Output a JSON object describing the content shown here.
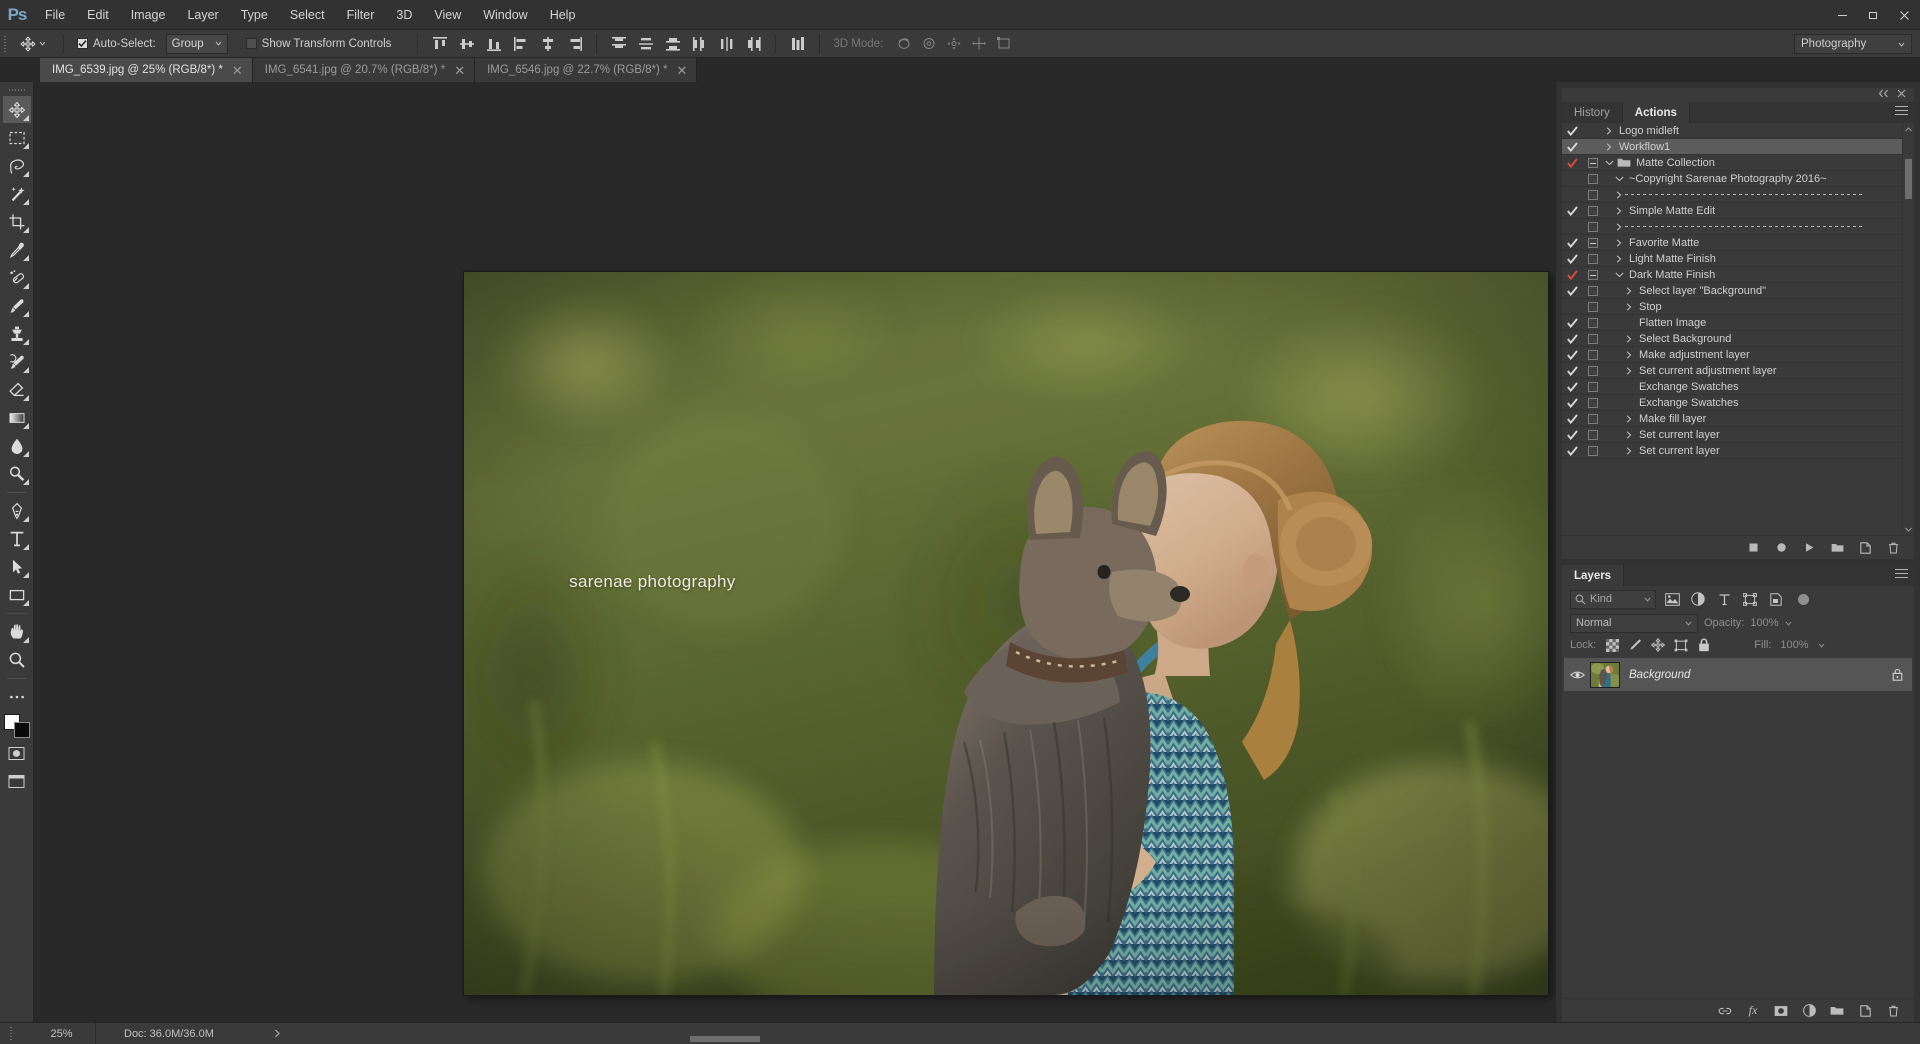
{
  "app": {
    "logo": "Ps",
    "menu": [
      "File",
      "Edit",
      "Image",
      "Layer",
      "Type",
      "Select",
      "Filter",
      "3D",
      "View",
      "Window",
      "Help"
    ],
    "window_controls": [
      "minimize",
      "restore",
      "close"
    ]
  },
  "options_bar": {
    "auto_select_label": "Auto-Select:",
    "auto_select_checked": true,
    "auto_select_value": "Group",
    "show_transform_label": "Show Transform Controls",
    "show_transform_checked": false,
    "mode_3d_label": "3D Mode:",
    "workspace": "Photography",
    "align_icons": [
      "align-top-edges",
      "align-vertical-centers",
      "align-bottom-edges",
      "align-left-edges",
      "align-horizontal-centers",
      "align-right-edges",
      "distribute-top-edges",
      "distribute-vertical-centers",
      "distribute-bottom-edges",
      "distribute-left-edges",
      "distribute-horizontal-centers",
      "distribute-right-edges",
      "align-distribute-options"
    ],
    "mode_3d_icons": [
      "3d-orbit",
      "3d-roll",
      "3d-pan",
      "3d-slide",
      "3d-scale"
    ]
  },
  "tabs": [
    {
      "label": "IMG_6539.jpg @ 25% (RGB/8*) *",
      "active": true
    },
    {
      "label": "IMG_6541.jpg @ 20.7% (RGB/8*) *",
      "active": false
    },
    {
      "label": "IMG_6546.jpg @ 22.7% (RGB/8*) *",
      "active": false
    }
  ],
  "toolbox": [
    {
      "name": "move-tool",
      "active": true,
      "more": true
    },
    {
      "name": "rectangular-marquee-tool",
      "active": false,
      "more": true
    },
    {
      "name": "lasso-tool",
      "active": false,
      "more": true
    },
    {
      "name": "magic-wand-tool",
      "active": false,
      "more": true
    },
    {
      "name": "crop-tool",
      "active": false,
      "more": true
    },
    {
      "name": "eyedropper-tool",
      "active": false,
      "more": true
    },
    {
      "name": "spot-healing-brush-tool",
      "active": false,
      "more": true
    },
    {
      "name": "brush-tool",
      "active": false,
      "more": true
    },
    {
      "name": "clone-stamp-tool",
      "active": false,
      "more": true
    },
    {
      "name": "history-brush-tool",
      "active": false,
      "more": true
    },
    {
      "name": "eraser-tool",
      "active": false,
      "more": true
    },
    {
      "name": "gradient-tool",
      "active": false,
      "more": true
    },
    {
      "name": "blur-tool",
      "active": false,
      "more": true
    },
    {
      "name": "dodge-tool",
      "active": false,
      "more": true
    },
    {
      "name": "pen-tool",
      "active": false,
      "more": true
    },
    {
      "name": "type-tool",
      "active": false,
      "more": true
    },
    {
      "name": "path-selection-tool",
      "active": false,
      "more": true
    },
    {
      "name": "rectangle-tool",
      "active": false,
      "more": true
    },
    {
      "name": "hand-tool",
      "active": false,
      "more": true
    },
    {
      "name": "zoom-tool",
      "active": false,
      "more": false
    },
    {
      "name": "edit-toolbar-tool",
      "active": false,
      "more": false
    }
  ],
  "canvas": {
    "watermark": "sarenae photography",
    "image_alt": "girl holding and kissing a yorkshire terrier in a green field"
  },
  "panels": {
    "actions": {
      "tabs": [
        {
          "label": "History",
          "active": false
        },
        {
          "label": "Actions",
          "active": true
        }
      ],
      "rows": [
        {
          "label": "Logo midleft",
          "checked": true,
          "box": "none",
          "arrow": "right",
          "indent": 0,
          "kind": "action",
          "selected": false
        },
        {
          "label": "Workflow1",
          "checked": true,
          "box": "none",
          "arrow": "right",
          "indent": 0,
          "kind": "action",
          "selected": true
        },
        {
          "label": "Matte Collection",
          "checked": "red",
          "box": "minus",
          "arrow": "down",
          "indent": 0,
          "kind": "set",
          "selected": false
        },
        {
          "label": "~Copyright Sarenae Photography 2016~",
          "checked": false,
          "box": "empty",
          "arrow": "down",
          "indent": 1,
          "kind": "action",
          "selected": false
        },
        {
          "label": "",
          "checked": false,
          "box": "empty",
          "arrow": "right",
          "indent": 1,
          "kind": "divider",
          "selected": false
        },
        {
          "label": "Simple Matte Edit",
          "checked": true,
          "box": "empty",
          "arrow": "right",
          "indent": 1,
          "kind": "action",
          "selected": false
        },
        {
          "label": "",
          "checked": false,
          "box": "empty",
          "arrow": "right",
          "indent": 1,
          "kind": "divider",
          "selected": false
        },
        {
          "label": "Favorite Matte",
          "checked": true,
          "box": "minus",
          "arrow": "right",
          "indent": 1,
          "kind": "action",
          "selected": false
        },
        {
          "label": "Light Matte Finish",
          "checked": true,
          "box": "empty",
          "arrow": "right",
          "indent": 1,
          "kind": "action",
          "selected": false
        },
        {
          "label": "Dark Matte Finish",
          "checked": "red",
          "box": "minus",
          "arrow": "down",
          "indent": 1,
          "kind": "action",
          "selected": false
        },
        {
          "label": "Select layer \"Background\"",
          "checked": true,
          "box": "empty",
          "arrow": "right",
          "indent": 2,
          "kind": "step",
          "selected": false
        },
        {
          "label": "Stop",
          "checked": false,
          "box": "empty",
          "arrow": "right",
          "indent": 2,
          "kind": "step",
          "selected": false
        },
        {
          "label": "Flatten Image",
          "checked": true,
          "box": "empty",
          "arrow": "none",
          "indent": 2,
          "kind": "step",
          "selected": false
        },
        {
          "label": "Select Background",
          "checked": true,
          "box": "empty",
          "arrow": "right",
          "indent": 2,
          "kind": "step",
          "selected": false
        },
        {
          "label": "Make adjustment layer",
          "checked": true,
          "box": "empty",
          "arrow": "right",
          "indent": 2,
          "kind": "step",
          "selected": false
        },
        {
          "label": "Set current adjustment layer",
          "checked": true,
          "box": "empty",
          "arrow": "right",
          "indent": 2,
          "kind": "step",
          "selected": false
        },
        {
          "label": "Exchange Swatches",
          "checked": true,
          "box": "empty",
          "arrow": "none",
          "indent": 2,
          "kind": "step",
          "selected": false
        },
        {
          "label": "Exchange Swatches",
          "checked": true,
          "box": "empty",
          "arrow": "none",
          "indent": 2,
          "kind": "step",
          "selected": false
        },
        {
          "label": "Make fill layer",
          "checked": true,
          "box": "empty",
          "arrow": "right",
          "indent": 2,
          "kind": "step",
          "selected": false
        },
        {
          "label": "Set current layer",
          "checked": true,
          "box": "empty",
          "arrow": "right",
          "indent": 2,
          "kind": "step",
          "selected": false
        },
        {
          "label": "Set current layer",
          "checked": true,
          "box": "empty",
          "arrow": "right",
          "indent": 2,
          "kind": "step",
          "selected": false
        }
      ],
      "footer_icons": [
        "stop-playing-recording",
        "begin-recording",
        "play-selection",
        "create-new-set",
        "create-new-action",
        "delete"
      ]
    },
    "layers": {
      "tabs": [
        {
          "label": "Layers",
          "active": true
        }
      ],
      "filter_kind_label": "Kind",
      "filter_icons": [
        "filter-pixel-layers",
        "filter-adjustment-layers",
        "filter-type-layers",
        "filter-shape-layers",
        "filter-smart-objects"
      ],
      "blend_mode": "Normal",
      "opacity_label": "Opacity:",
      "opacity_value": "100%",
      "lock_label": "Lock:",
      "lock_icons": [
        "lock-transparent-pixels",
        "lock-image-pixels",
        "lock-position",
        "lock-artboard-nesting",
        "lock-all"
      ],
      "fill_label": "Fill:",
      "fill_value": "100%",
      "items": [
        {
          "name": "Background",
          "visible": true,
          "locked": true,
          "selected": true
        }
      ],
      "footer_icons": [
        "link-layers",
        "add-layer-style-fx",
        "add-layer-mask",
        "new-fill-or-adjustment-layer",
        "create-new-group",
        "create-new-layer",
        "delete-layer"
      ]
    }
  },
  "status_bar": {
    "zoom": "25%",
    "doc_info": "Doc: 36.0M/36.0M"
  },
  "colors": {
    "menubar_bg": "#323232",
    "options_bg": "#3a3a3a",
    "panel_bg": "#3a3a3a",
    "canvas_bg": "#292929",
    "selected_row": "#5c5c5c",
    "accent_red": "#e04a3f",
    "logo_blue": "#7da7c4",
    "foreground_swatch": "#ffffff",
    "background_swatch": "#000000"
  }
}
